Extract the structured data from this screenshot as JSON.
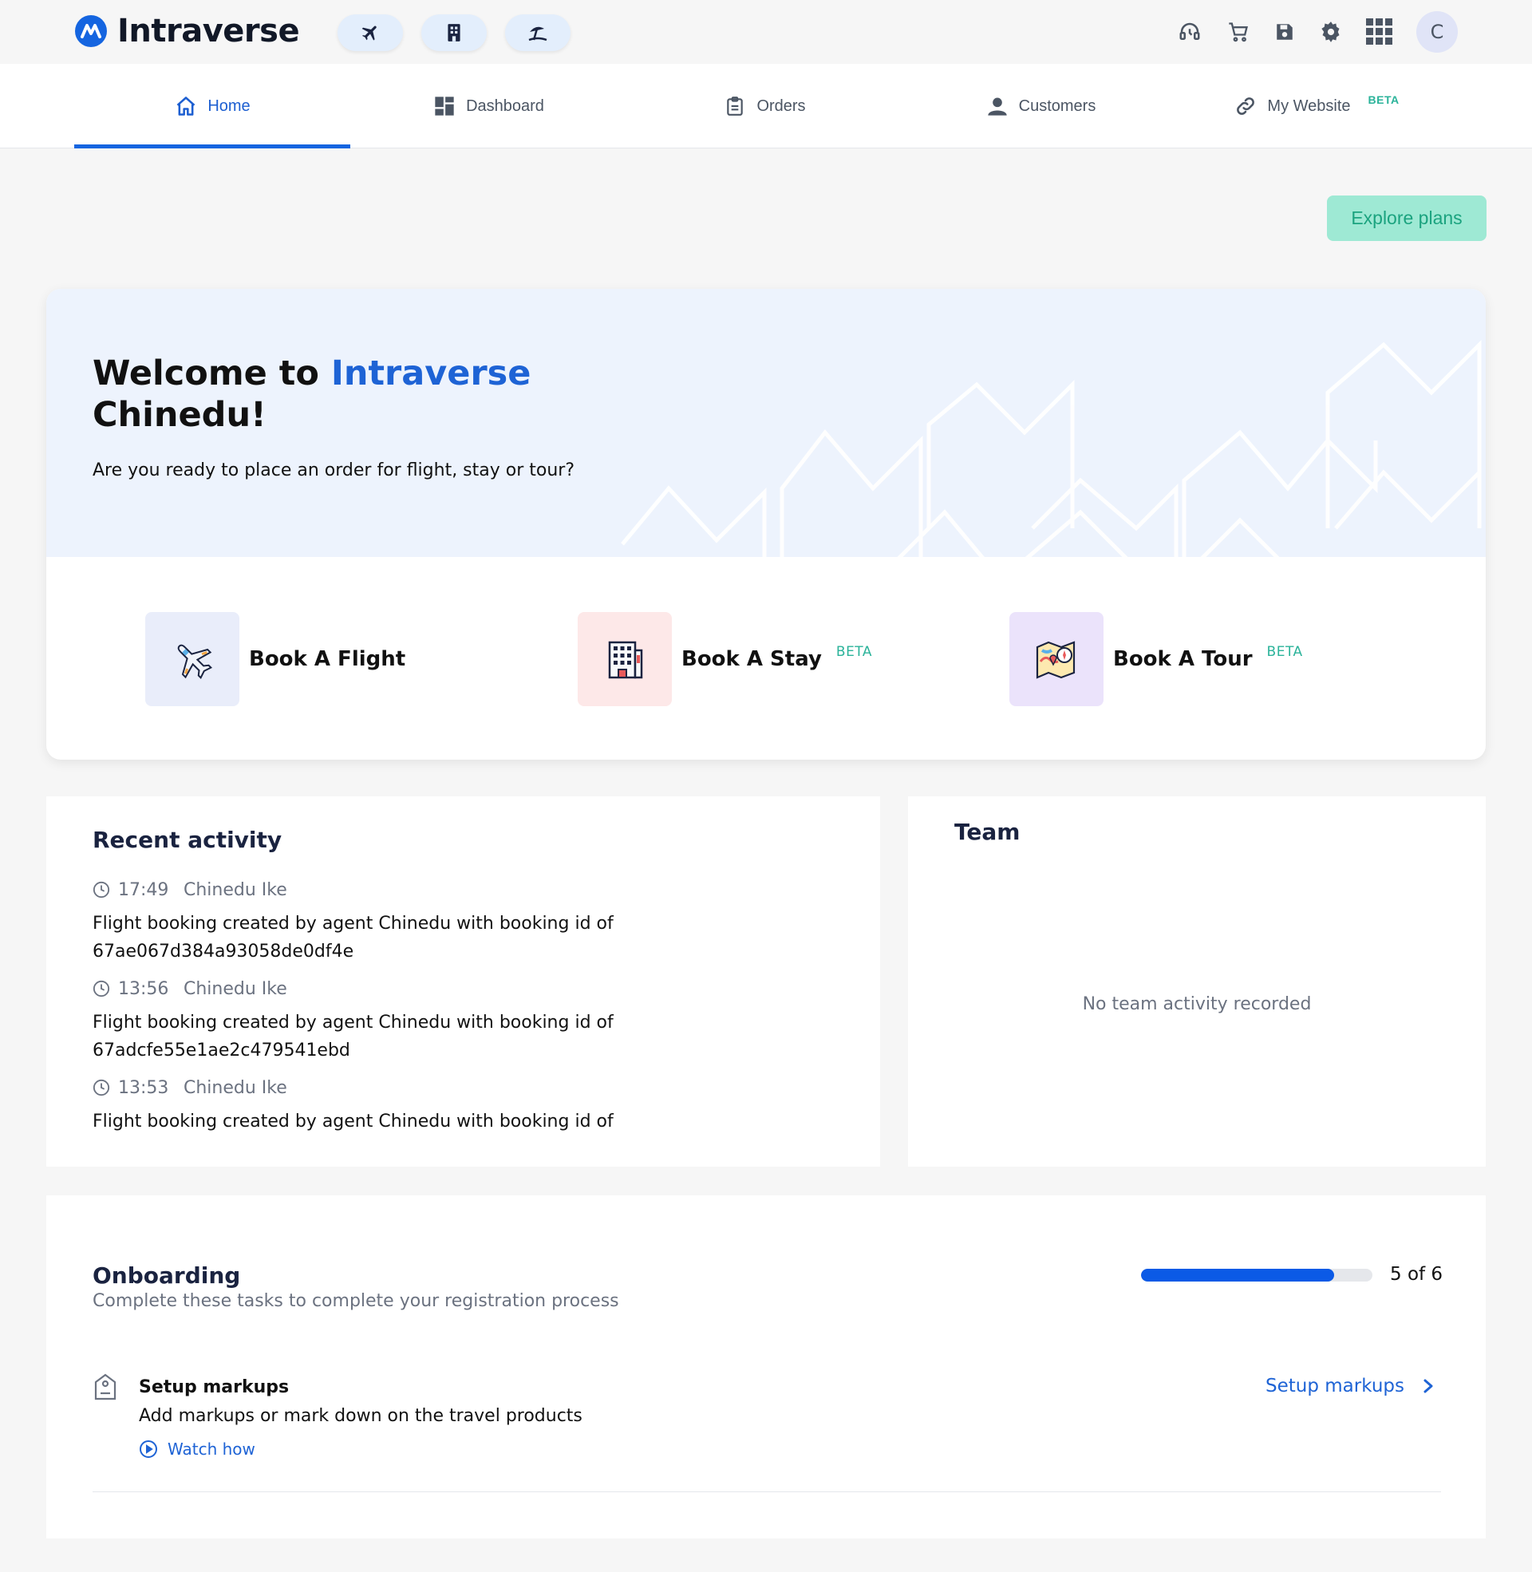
{
  "app": {
    "name": "Intraverse",
    "user_initial": "C"
  },
  "topbar": {
    "quick_actions": [
      {
        "icon": "airplane-icon"
      },
      {
        "icon": "building-icon"
      },
      {
        "icon": "beach-umbrella-icon"
      }
    ],
    "icons": [
      "support-headset-icon",
      "cart-icon",
      "save-icon",
      "gear-icon",
      "apps-grid-icon"
    ]
  },
  "nav": {
    "tabs": [
      {
        "label": "Home",
        "icon": "home-icon",
        "active": true
      },
      {
        "label": "Dashboard",
        "icon": "dashboard-icon"
      },
      {
        "label": "Orders",
        "icon": "clipboard-icon"
      },
      {
        "label": "Customers",
        "icon": "person-icon"
      },
      {
        "label": "My Website",
        "icon": "link-icon",
        "badge": "BETA"
      }
    ]
  },
  "explore_label": "Explore plans",
  "welcome": {
    "title_prefix": "Welcome to",
    "brand": "Intraverse",
    "name_line": "Chinedu!",
    "subtitle": "Are you ready to place an order for flight, stay or tour?",
    "actions": [
      {
        "label": "Book A Flight",
        "icon": "airplane-icon",
        "tile_color": "#e9edfa"
      },
      {
        "label": "Book A Stay",
        "icon": "hotel-icon",
        "tile_color": "#fde8e8",
        "badge": "BETA"
      },
      {
        "label": "Book A Tour",
        "icon": "map-icon",
        "tile_color": "#ebe3fb",
        "badge": "BETA"
      }
    ]
  },
  "recent_activity": {
    "title": "Recent activity",
    "entries": [
      {
        "time": "17:49",
        "user": "Chinedu Ike",
        "text": "Flight booking created by agent Chinedu with booking id of 67ae067d384a93058de0df4e"
      },
      {
        "time": "13:56",
        "user": "Chinedu Ike",
        "text": "Flight booking created by agent Chinedu with booking id of 67adcfe55e1ae2c479541ebd"
      },
      {
        "time": "13:53",
        "user": "Chinedu Ike",
        "text": "Flight booking created by agent Chinedu with booking id of"
      }
    ]
  },
  "team": {
    "title": "Team",
    "empty": "No team activity recorded"
  },
  "onboarding": {
    "title": "Onboarding",
    "subtitle": "Complete these tasks to complete your registration process",
    "progress_text": "5 of 6",
    "progress_fraction": 0.833,
    "task": {
      "title": "Setup markups",
      "description": "Add markups or mark down on the travel products",
      "watch_label": "Watch how",
      "link_label": "Setup markups"
    }
  },
  "colors": {
    "accent": "#1565e0",
    "brand_text": "#1e63d5",
    "beta": "#2bb39a",
    "explore_bg": "#9ee9d4"
  }
}
